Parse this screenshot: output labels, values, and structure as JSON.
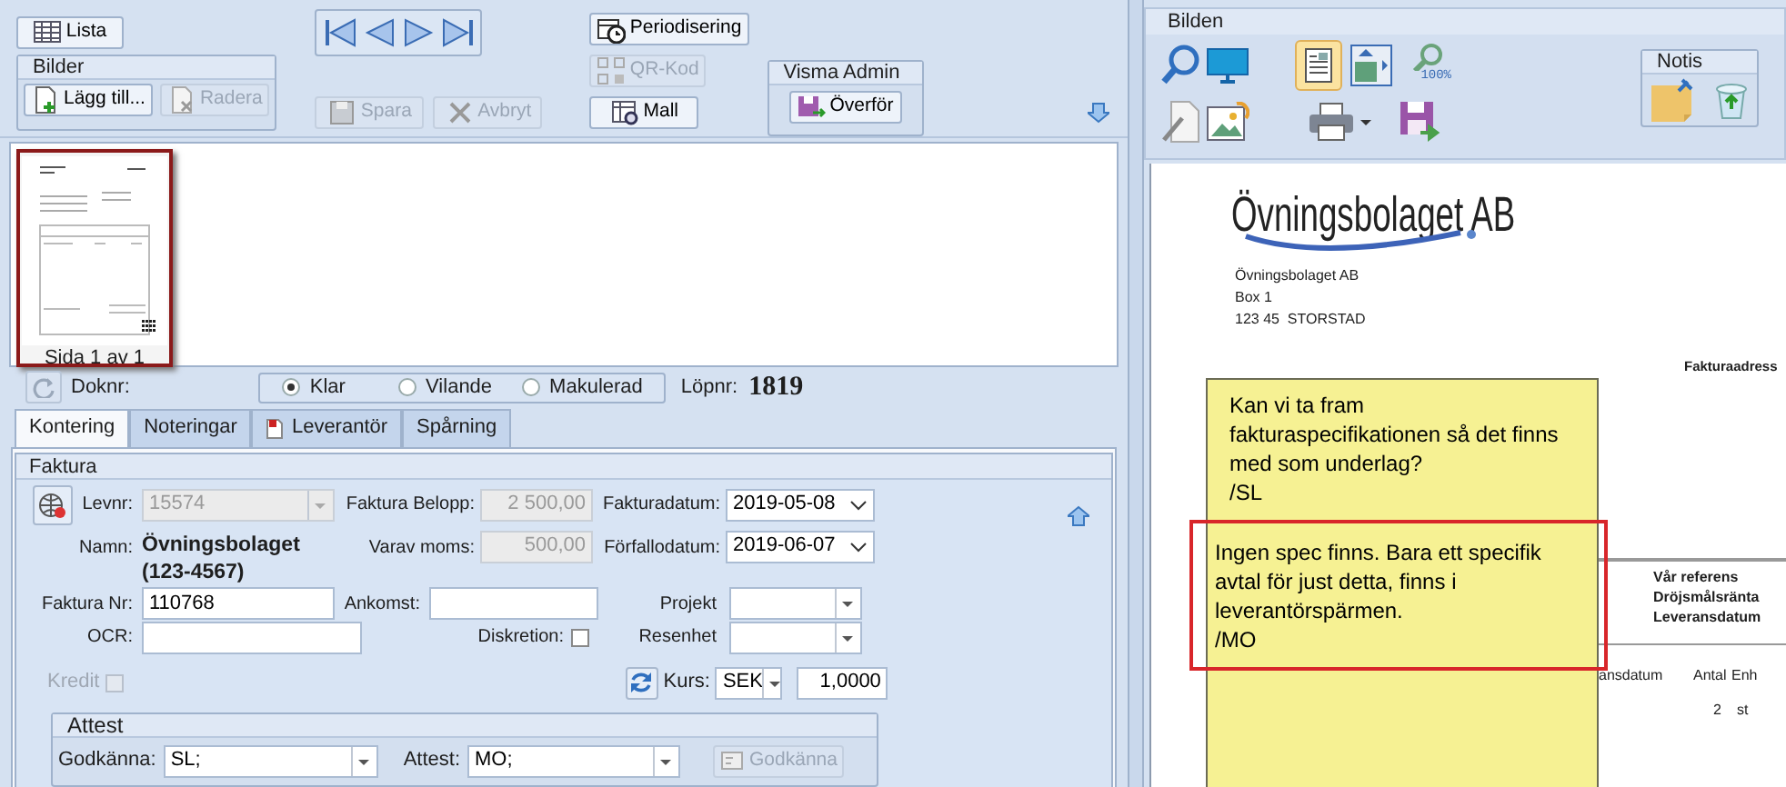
{
  "toolbar": {
    "list_button": {
      "label": "Lista",
      "disabled": false
    },
    "images_group": {
      "title": "Bilder",
      "buttons": [
        {
          "kind": "add",
          "label": "Lägg till...",
          "disabled": false
        },
        {
          "kind": "delete",
          "label": "Radera",
          "disabled": true
        }
      ]
    },
    "edit_buttons": [
      {
        "kind": "save",
        "label": "Spara",
        "disabled": true
      },
      {
        "kind": "cancel",
        "label": "Avbryt",
        "disabled": true
      }
    ],
    "tool_buttons": [
      {
        "kind": "period",
        "label": "Periodisering",
        "disabled": false
      },
      {
        "kind": "qr",
        "label": "QR-Kod",
        "disabled": true
      },
      {
        "kind": "template",
        "label": "Mall",
        "disabled": false
      }
    ],
    "admin_group": {
      "title": "Visma Admin",
      "button": {
        "label": "Överför",
        "disabled": false
      }
    }
  },
  "thumbnails": [
    {
      "caption": "Sida 1 av 1",
      "selected": true
    }
  ],
  "document_bar": {
    "doc_no_label": "Doknr:",
    "statuses": [
      {
        "label": "Klar",
        "selected": true
      },
      {
        "label": "Vilande",
        "selected": false
      },
      {
        "label": "Makulerad",
        "selected": false
      }
    ],
    "serial_label": "Löpnr:",
    "serial": "1819"
  },
  "tabs": [
    {
      "label": "Kontering",
      "selected": true,
      "icon": false
    },
    {
      "label": "Noteringar",
      "selected": false,
      "icon": false
    },
    {
      "label": "Leverantör",
      "selected": false,
      "icon": true
    },
    {
      "label": "Spårning",
      "selected": false,
      "icon": false
    }
  ],
  "invoice": {
    "title": "Faktura",
    "supplier_no": {
      "label": "Levnr:",
      "value": "15574",
      "disabled": true
    },
    "amount": {
      "label": "Faktura Belopp:",
      "value": "2 500,00",
      "disabled": true
    },
    "invoice_date": {
      "label": "Fakturadatum:",
      "value": "2019-05-08"
    },
    "name": {
      "label": "Namn:",
      "value": "Övningsbolaget (123-4567)"
    },
    "vat": {
      "label": "Varav moms:",
      "value": "500,00",
      "disabled": true
    },
    "due_date": {
      "label": "Förfallodatum:",
      "value": "2019-06-07"
    },
    "invoice_no": {
      "label": "Faktura Nr:",
      "value": "110768"
    },
    "arrival": {
      "label": "Ankomst:"
    },
    "project": {
      "label": "Projekt"
    },
    "ocr": {
      "label": "OCR:"
    },
    "discretion": {
      "label": "Diskretion:",
      "checked": false
    },
    "travel_unit": {
      "label": "Resenhet"
    },
    "credit": {
      "label": "Kredit",
      "checked": false,
      "disabled": true
    },
    "rate": {
      "label": "Kurs:",
      "currency": "SEK",
      "value": "1,0000"
    },
    "attest": {
      "title": "Attest",
      "approve": {
        "label": "Godkänna:",
        "value": "SL;"
      },
      "attest": {
        "label": "Attest:",
        "value": "MO;"
      },
      "button": {
        "label": "Godkänna",
        "disabled": true
      }
    }
  },
  "viewer": {
    "title": "Bilden",
    "zoom_label": "100%",
    "layout_selected": true,
    "notes_group": {
      "title": "Notis"
    }
  },
  "document": {
    "company_logo": "Övningsbolaget AB",
    "address": [
      "Övningsbolaget AB",
      "Box 1",
      "123 45  STORSTAD"
    ],
    "address_heading": "Fakturaadress",
    "reference_labels": [
      "Vår referens",
      "Dröjsmålsränta",
      "Leveransdatum"
    ],
    "columns": [
      "ansdatum",
      "Antal",
      "Enh"
    ],
    "rows": [
      [
        "",
        "2",
        "st"
      ]
    ]
  },
  "note": {
    "entries": [
      {
        "text": "Kan vi ta fram\nfakturaspecifikationen så det finns\nmed som underlag?\n/SL",
        "highlighted": false
      },
      {
        "text": "Ingen spec finns. Bara ett specifik\navtal för just detta, finns i\nleverantörspärmen.\n/MO",
        "highlighted": true
      }
    ]
  }
}
